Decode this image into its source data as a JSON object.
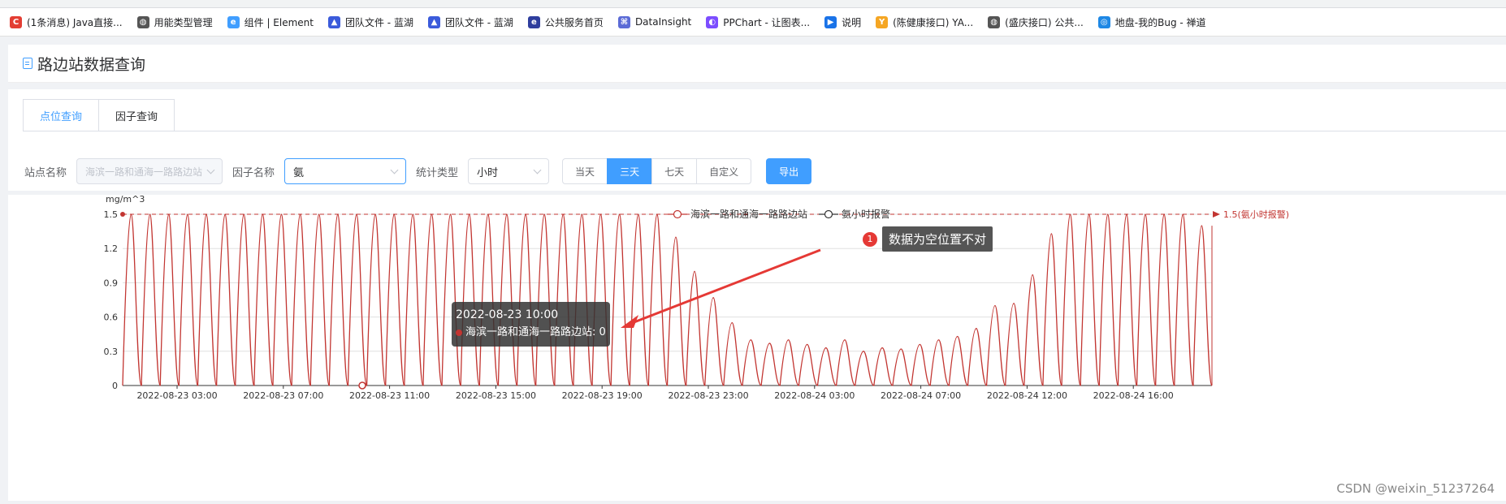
{
  "bookmarks": [
    {
      "label": "(1条消息) Java直接...",
      "icon": "csdn-icon",
      "color": "#e33e33",
      "glyph": "C"
    },
    {
      "label": "用能类型管理",
      "icon": "globe-icon",
      "color": "#555555",
      "glyph": "◍"
    },
    {
      "label": "组件 | Element",
      "icon": "element-icon",
      "color": "#409eff",
      "glyph": "e"
    },
    {
      "label": "团队文件 - 蓝湖",
      "icon": "lanhu-icon",
      "color": "#3b5bdb",
      "glyph": "▲"
    },
    {
      "label": "团队文件 - 蓝湖",
      "icon": "lanhu-icon",
      "color": "#3b5bdb",
      "glyph": "▲"
    },
    {
      "label": "公共服务首页",
      "icon": "service-icon",
      "color": "#2f3e9e",
      "glyph": "e"
    },
    {
      "label": "DataInsight",
      "icon": "datainsight-icon",
      "color": "#5b6bd6",
      "glyph": "⌘"
    },
    {
      "label": "PPChart - 让图表...",
      "icon": "ppchart-icon",
      "color": "#7c4dff",
      "glyph": "◐"
    },
    {
      "label": "说明",
      "icon": "video-icon",
      "color": "#1a73e8",
      "glyph": "▶"
    },
    {
      "label": "(陈健康接口) YA...",
      "icon": "yapi-icon",
      "color": "#f5a623",
      "glyph": "Y"
    },
    {
      "label": "(盛庆接口) 公共...",
      "icon": "globe-icon",
      "color": "#555555",
      "glyph": "◍"
    },
    {
      "label": "地盘-我的Bug - 禅道",
      "icon": "zentao-icon",
      "color": "#1e88e5",
      "glyph": "◎"
    }
  ],
  "page": {
    "title": "路边站数据查询"
  },
  "tabs": [
    {
      "label": "点位查询",
      "active": true
    },
    {
      "label": "因子查询",
      "active": false
    }
  ],
  "filters": {
    "station_label": "站点名称",
    "station_placeholder": "海滨一路和通海一路路边站",
    "factor_label": "因子名称",
    "factor_value": "氨",
    "stat_label": "统计类型",
    "stat_value": "小时",
    "range_buttons": [
      {
        "label": "当天",
        "active": false
      },
      {
        "label": "三天",
        "active": true
      },
      {
        "label": "七天",
        "active": false
      },
      {
        "label": "自定义",
        "active": false
      }
    ],
    "export_label": "导出"
  },
  "chart_data": {
    "type": "line",
    "ylabel": "mg/m^3",
    "ylim": [
      0,
      1.5
    ],
    "yticks": [
      "0",
      "0.3",
      "0.6",
      "0.9",
      "1.2",
      "1.5"
    ],
    "xticks": [
      "2022-08-23 03:00",
      "2022-08-23 07:00",
      "2022-08-23 11:00",
      "2022-08-23 15:00",
      "2022-08-23 19:00",
      "2022-08-23 23:00",
      "2022-08-24 03:00",
      "2022-08-24 07:00",
      "2022-08-24 12:00",
      "2022-08-24 16:00"
    ],
    "legend": [
      {
        "name": "海滨一路和通海一路路边站",
        "color": "#c23531"
      },
      {
        "name": "氨小时报警",
        "color": "#333333"
      }
    ],
    "series_peaks": [
      1.5,
      1.5,
      1.5,
      1.5,
      1.5,
      1.5,
      1.5,
      1.5,
      1.5,
      1.5,
      1.5,
      1.5,
      1.5,
      1.5,
      1.5,
      1.5,
      1.5,
      1.5,
      1.5,
      1.5,
      1.5,
      1.5,
      1.5,
      1.5,
      1.5,
      1.5,
      1.5,
      1.5,
      1.5,
      1.5,
      1.5,
      1.5,
      1.5,
      1.5,
      1.5,
      1.5,
      1.5,
      1.5,
      1.5,
      1.5,
      1.5,
      1.5,
      1.5,
      1.5,
      1.5,
      1.5,
      1.5,
      1.5,
      1.5,
      1.5,
      1.5,
      1.5,
      1.5,
      1.5,
      1.5,
      1.5,
      1.5,
      1.5,
      1.5,
      1.5,
      1.5,
      1.5,
      1.5,
      1.5,
      1.5,
      1.5,
      1.5,
      1.5,
      1.5,
      1.5,
      1.5,
      1.5,
      1.5,
      1.5,
      1.5,
      1.5,
      1.5,
      1.5,
      1.5,
      1.5,
      1.5,
      1.5,
      1.5,
      1.5,
      1.5,
      1.5,
      1.5,
      1.5,
      1.5,
      1.5,
      1.5,
      1.5,
      1.5,
      1.5,
      1.5,
      1.5,
      1.5,
      1.5,
      1.5,
      1.5,
      1.5,
      1.5,
      1.5,
      1.5,
      1.5,
      1.5,
      1.5,
      1.5,
      1.5,
      1.5,
      1.5,
      1.5,
      1.5,
      1.5,
      1.5,
      1.5,
      1.5,
      1.5,
      1.5,
      1.5,
      1.5,
      1.5,
      1.5,
      1.5,
      1.5,
      1.5,
      1.5,
      1.5,
      1.5,
      1.5,
      1.5,
      1.5,
      1.5,
      1.5,
      1.5,
      1.5,
      1.5,
      1.5
    ],
    "wave_peaks": [
      1.5,
      1.5,
      1.5,
      1.5,
      1.5,
      1.5,
      1.5,
      1.5,
      1.5,
      1.5,
      1.5,
      1.5,
      1.5,
      1.5,
      1.5,
      1.5,
      1.5,
      1.5,
      1.5,
      1.5,
      1.5,
      1.5,
      1.5,
      1.5,
      1.5,
      1.5,
      1.5,
      1.5,
      1.5,
      1.3,
      1.0,
      0.77,
      0.55,
      0.4,
      0.37,
      0.4,
      0.36,
      0.33,
      0.4,
      0.3,
      0.33,
      0.32,
      0.36,
      0.4,
      0.43,
      0.5,
      0.7,
      0.72,
      0.97,
      1.33,
      1.5,
      1.5,
      1.5,
      1.5,
      1.5,
      1.5,
      1.5,
      1.4
    ],
    "alarm_line": {
      "value": 1.5,
      "label": "1.5(氨小时报警)"
    },
    "tooltip": {
      "title": "2022-08-23 10:00",
      "series": "海滨一路和通海一路路边站",
      "value": "0"
    },
    "annotation": {
      "badge": "1",
      "text": "数据为空位置不对"
    }
  },
  "watermark": "CSDN @weixin_51237264"
}
